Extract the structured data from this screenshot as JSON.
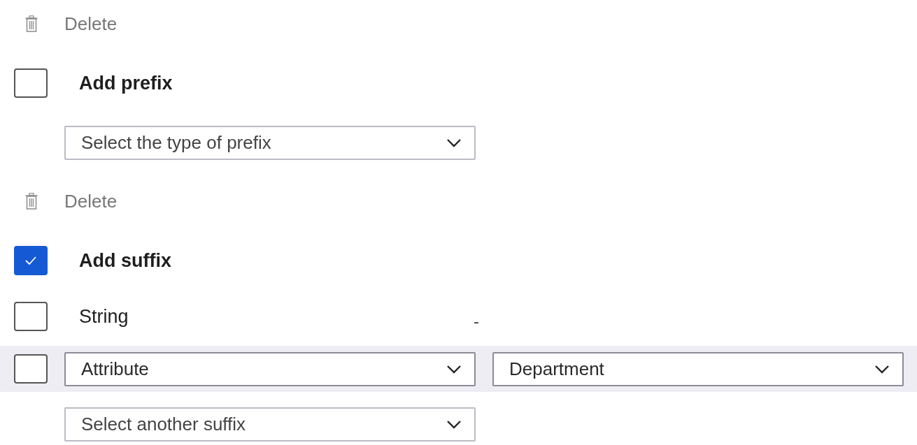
{
  "items": [
    {
      "kind": "delete",
      "label": "Delete"
    },
    {
      "kind": "checkbox",
      "label": "Add prefix",
      "checked": false
    },
    {
      "kind": "dropdown",
      "placeholder": "Select the type of prefix"
    },
    {
      "kind": "delete",
      "label": "Delete"
    },
    {
      "kind": "checkbox",
      "label": "Add suffix",
      "checked": true
    },
    {
      "kind": "string",
      "label": "String",
      "checked": false,
      "value": "-"
    },
    {
      "kind": "attribute",
      "checked": false,
      "type": "Attribute",
      "attribute": "Department"
    },
    {
      "kind": "dropdown",
      "placeholder": "Select another suffix"
    }
  ]
}
